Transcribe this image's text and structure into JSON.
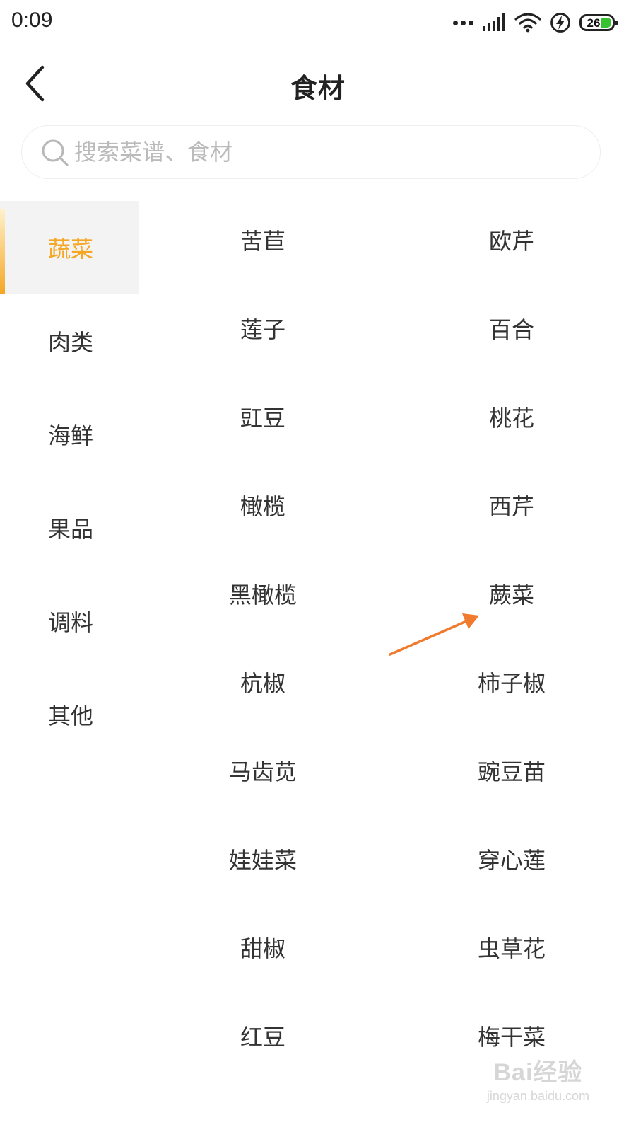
{
  "status_bar": {
    "time": "0:09",
    "battery_level": "26",
    "icons": [
      "more-dots-icon",
      "signal-icon",
      "wifi-icon",
      "charging-icon",
      "battery-icon"
    ]
  },
  "header": {
    "back_icon": "chevron-left-icon",
    "title": "食材"
  },
  "search": {
    "placeholder": "搜索菜谱、食材",
    "value": ""
  },
  "categories": [
    {
      "label": "蔬菜",
      "active": true
    },
    {
      "label": "肉类",
      "active": false
    },
    {
      "label": "海鲜",
      "active": false
    },
    {
      "label": "果品",
      "active": false
    },
    {
      "label": "调料",
      "active": false
    },
    {
      "label": "其他",
      "active": false
    }
  ],
  "foods": [
    "苦苣",
    "欧芹",
    "莲子",
    "百合",
    "豇豆",
    "桃花",
    "橄榄",
    "西芹",
    "黑橄榄",
    "蕨菜",
    "杭椒",
    "柿子椒",
    "马齿苋",
    "豌豆苗",
    "娃娃菜",
    "穿心莲",
    "甜椒",
    "虫草花",
    "红豆",
    "梅干菜"
  ],
  "colors": {
    "accent": "#f5a623",
    "active_bg": "#f3f3f3",
    "text": "#333333",
    "placeholder": "#bbbbbb",
    "annotation": "#f07a2d"
  },
  "watermark": {
    "logo": "Bai经验",
    "url": "jingyan.baidu.com"
  }
}
